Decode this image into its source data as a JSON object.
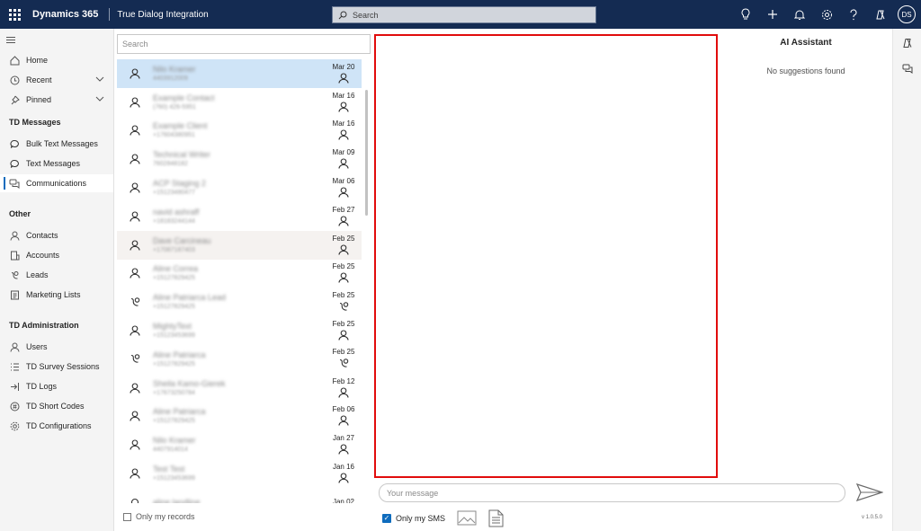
{
  "topbar": {
    "brand": "Dynamics 365",
    "app_name": "True Dialog Integration",
    "search_placeholder": "Search",
    "user_initials": "DS",
    "icons": [
      "lightbulb-icon",
      "plus-icon",
      "bell-icon",
      "gear-icon",
      "help-icon",
      "copilot-icon"
    ]
  },
  "nav": {
    "home": "Home",
    "recent": "Recent",
    "pinned": "Pinned",
    "group_td_messages": "TD Messages",
    "bulk_text_messages": "Bulk Text Messages",
    "text_messages": "Text Messages",
    "communications": "Communications",
    "group_other": "Other",
    "contacts": "Contacts",
    "accounts": "Accounts",
    "leads": "Leads",
    "marketing_lists": "Marketing Lists",
    "group_td_admin": "TD Administration",
    "users": "Users",
    "td_survey_sessions": "TD Survey Sessions",
    "td_logs": "TD Logs",
    "td_short_codes": "TD Short Codes",
    "td_configurations": "TD Configurations"
  },
  "list": {
    "search_placeholder": "Search",
    "only_my_records": "Only my records",
    "contacts": [
      {
        "name": "Nilo Kramer",
        "sub": "4403912009",
        "date": "Mar 20",
        "kind": "person"
      },
      {
        "name": "Example Contact",
        "sub": "(760) 426-5951",
        "date": "Mar 16",
        "kind": "person"
      },
      {
        "name": "Example Client",
        "sub": "+17604380951",
        "date": "Mar 16",
        "kind": "person"
      },
      {
        "name": "Technical Writer",
        "sub": "7602848182",
        "date": "Mar 09",
        "kind": "person"
      },
      {
        "name": "ACP Staging 2",
        "sub": "+15123480477",
        "date": "Mar 06",
        "kind": "person"
      },
      {
        "name": "navid ashraff",
        "sub": "+18183244144",
        "date": "Feb 27",
        "kind": "person"
      },
      {
        "name": "Dave Carcineau",
        "sub": "+17087187403",
        "date": "Feb 25",
        "kind": "person"
      },
      {
        "name": "Aline Correa",
        "sub": "+15127829425",
        "date": "Feb 25",
        "kind": "person"
      },
      {
        "name": "Aline Patriarca Lead",
        "sub": "+15127829425",
        "date": "Feb 25",
        "kind": "lead"
      },
      {
        "name": "MightyText",
        "sub": "+15123453699",
        "date": "Feb 25",
        "kind": "person"
      },
      {
        "name": "Aline Patriarca",
        "sub": "+15127829425",
        "date": "Feb 25",
        "kind": "lead"
      },
      {
        "name": "Sheila Kamo-Gierek",
        "sub": "+17673250784",
        "date": "Feb 12",
        "kind": "person"
      },
      {
        "name": "Aline Patriarca",
        "sub": "+15127829425",
        "date": "Feb 06",
        "kind": "person"
      },
      {
        "name": "Nilo Kramer",
        "sub": "4407914014",
        "date": "Jan 27",
        "kind": "person"
      },
      {
        "name": "Test Test",
        "sub": "+15123453699",
        "date": "Jan 16",
        "kind": "person"
      },
      {
        "name": "aline landline",
        "sub": "",
        "date": "Jan 02",
        "kind": "circle"
      }
    ]
  },
  "conversation": {
    "message_placeholder": "Your message",
    "only_my_sms": "Only my SMS",
    "version": "v 1.0.5.0"
  },
  "ai": {
    "title": "AI Assistant",
    "empty_text": "No suggestions found"
  },
  "colors": {
    "topbar": "#142b52",
    "accent": "#0f6cbd",
    "selected_row": "#cfe4f7",
    "highlight_border": "#e10c0c"
  }
}
